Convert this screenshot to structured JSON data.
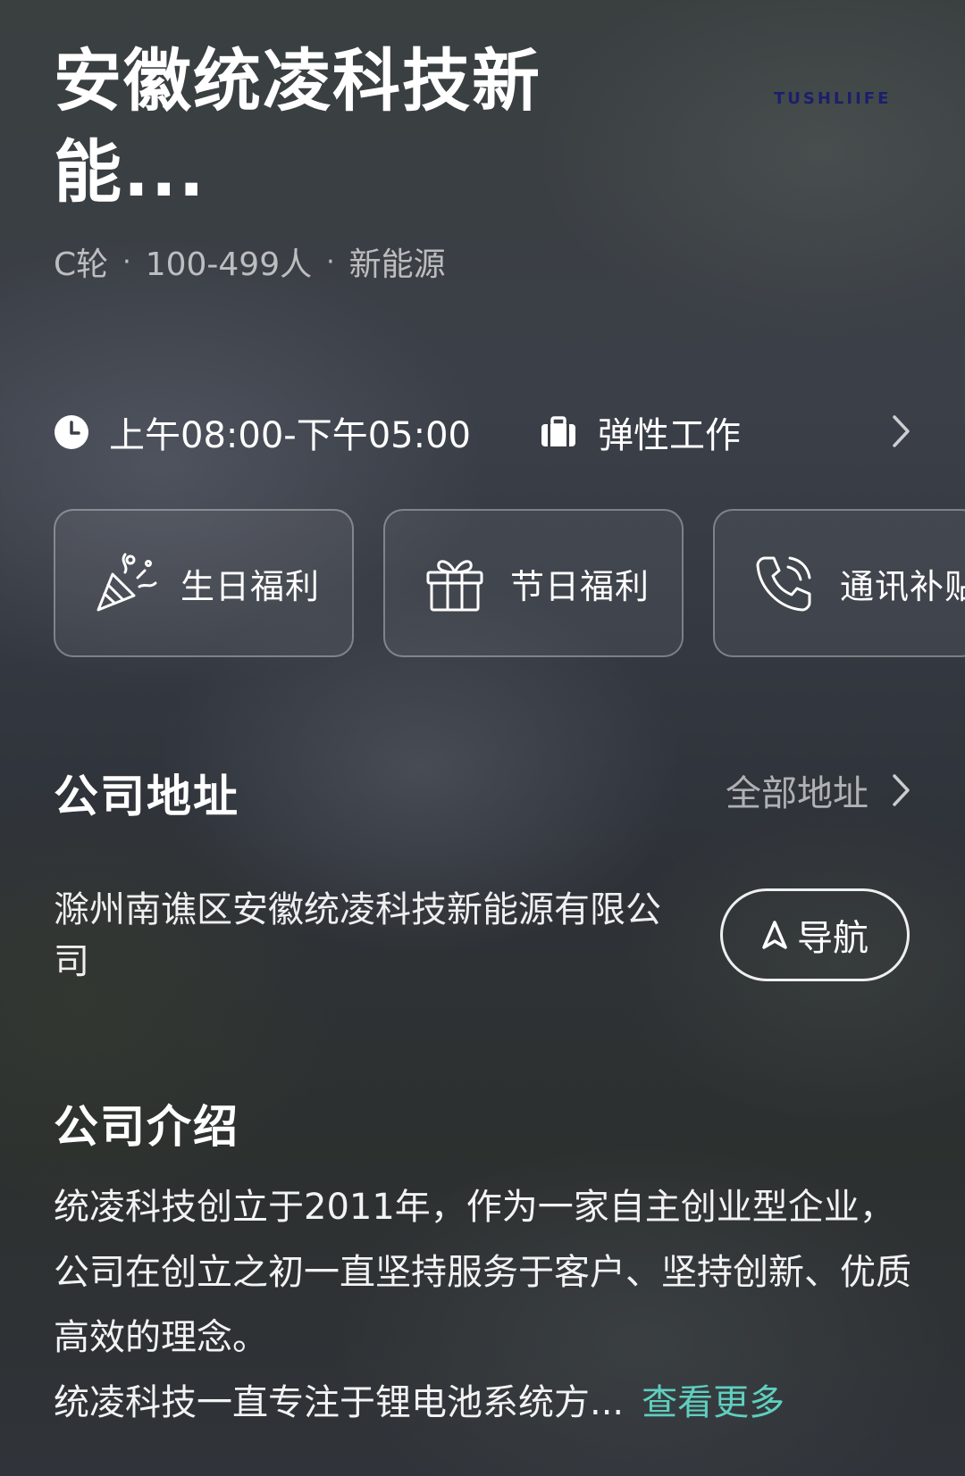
{
  "company": {
    "name": "安徽统凌科技新能...",
    "funding_stage": "C轮",
    "size": "100-499人",
    "industry": "新能源",
    "separator": "·"
  },
  "watermark": "TUSHLIIFE",
  "work_info": {
    "hours": "上午08:00-下午05:00",
    "work_mode": "弹性工作"
  },
  "benefits": [
    {
      "label": "生日福利",
      "icon": "party-popper-icon"
    },
    {
      "label": "节日福利",
      "icon": "gift-icon"
    },
    {
      "label": "通讯补贴",
      "icon": "phone-icon"
    }
  ],
  "address_section": {
    "title": "公司地址",
    "all_label": "全部地址",
    "address": "滁州南谯区安徽统凌科技新能源有限公司",
    "navigate_label": "导航"
  },
  "intro_section": {
    "title": "公司介绍",
    "paragraph1": "统凌科技创立于2011年，作为一家自主创业型企业，公司在创立之初一直坚持服务于客户、坚持创新、优质高效的理念。",
    "paragraph2": "统凌科技一直专注于锂电池系统方...",
    "more_label": "查看更多"
  },
  "colors": {
    "accent_link": "#5fcfbf",
    "text_primary": "#ffffff",
    "watermark": "#1b1f6a"
  }
}
